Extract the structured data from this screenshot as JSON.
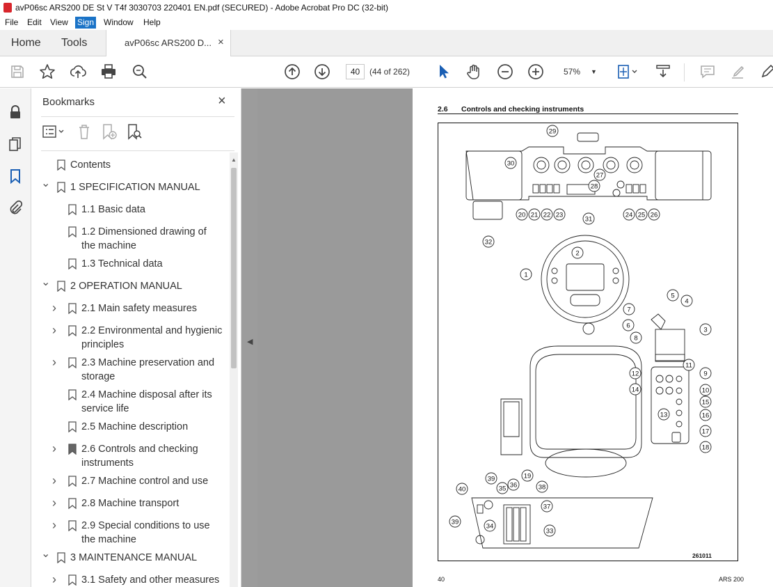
{
  "window": {
    "title": "avP06sc ARS200 DE St V T4f 3030703 220401 EN.pdf (SECURED) - Adobe Acrobat Pro DC (32-bit)"
  },
  "menu": [
    "File",
    "Edit",
    "View",
    "Sign",
    "Window",
    "Help"
  ],
  "menu_active": "Sign",
  "tabs": {
    "home": "Home",
    "tools": "Tools",
    "document": "avP06sc ARS200 D...",
    "close": "×"
  },
  "toolbar": {
    "page_current": "40",
    "page_count": "(44 of 262)",
    "zoom": "57%",
    "icons": [
      "save-icon",
      "star-icon",
      "upload-icon",
      "print-icon",
      "search-zoom-icon",
      "arrow-up-icon",
      "arrow-down-icon",
      "select-cursor-icon",
      "hand-icon",
      "zoom-out-icon",
      "zoom-in-icon",
      "fit-page-icon",
      "scroll-mode-icon",
      "comment-icon",
      "highlight-icon",
      "draw-icon"
    ]
  },
  "bookmarks": {
    "title": "Bookmarks",
    "close": "×",
    "items": [
      {
        "label": "Contents",
        "level": 0,
        "chevron": "none"
      },
      {
        "label": "1 SPECIFICATION MANUAL",
        "level": 0,
        "chevron": "down"
      },
      {
        "label": "1.1 Basic data",
        "level": 1,
        "chevron": "none"
      },
      {
        "label": "1.2 Dimensioned drawing of",
        "label2": "the machine",
        "level": 1,
        "chevron": "none"
      },
      {
        "label": "1.3 Technical data",
        "level": 1,
        "chevron": "none"
      },
      {
        "label": "2 OPERATION MANUAL",
        "level": 0,
        "chevron": "down"
      },
      {
        "label": "2.1 Main safety measures",
        "level": 1,
        "chevron": "right"
      },
      {
        "label": "2.2 Environmental and hygienic",
        "label2": "principles",
        "level": 1,
        "chevron": "right"
      },
      {
        "label": "2.3 Machine preservation and",
        "label2": "storage",
        "level": 1,
        "chevron": "right"
      },
      {
        "label": "2.4 Machine disposal after its",
        "label2": "service life",
        "level": 1,
        "chevron": "none"
      },
      {
        "label": "2.5 Machine description",
        "level": 1,
        "chevron": "none"
      },
      {
        "label": "2.6 Controls and checking",
        "label2": "instruments",
        "level": 1,
        "chevron": "right",
        "current": true
      },
      {
        "label": "2.7 Machine control and use",
        "level": 1,
        "chevron": "right"
      },
      {
        "label": "2.8 Machine transport",
        "level": 1,
        "chevron": "right"
      },
      {
        "label": "2.9 Special conditions to use",
        "label2": "the machine",
        "level": 1,
        "chevron": "right"
      },
      {
        "label": "3 MAINTENANCE MANUAL",
        "level": 0,
        "chevron": "down"
      },
      {
        "label": "3.1 Safety and other measures",
        "level": 1,
        "chevron": "right"
      }
    ]
  },
  "page": {
    "section_number": "2.6",
    "section_title": "Controls and checking instruments",
    "figure_code": "261011",
    "footer_page": "40",
    "footer_model": "ARS 200",
    "callouts": [
      "1",
      "2",
      "3",
      "4",
      "5",
      "6",
      "7",
      "8",
      "9",
      "10",
      "11",
      "12",
      "13",
      "14",
      "15",
      "16",
      "17",
      "18",
      "19",
      "20",
      "21",
      "22",
      "23",
      "24",
      "25",
      "26",
      "27",
      "28",
      "29",
      "30",
      "31",
      "32",
      "33",
      "34",
      "35",
      "36",
      "37",
      "38",
      "39",
      "39",
      "40"
    ]
  }
}
